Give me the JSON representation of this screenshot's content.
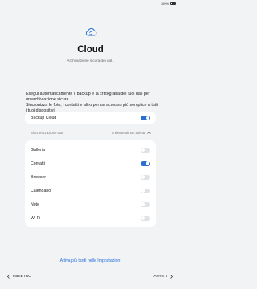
{
  "status_bar": {
    "battery": "100%"
  },
  "hero": {
    "icon": "cloud-sync-icon",
    "title": "Cloud",
    "subtitle": "Archiviazione sicura dei dati."
  },
  "description": {
    "line1": "Esegui automaticamente il backup e la crittografia dei tuoi dati per un'archiviazione sicura.",
    "line2": "Sincronizza le foto, i contatti e altro per un accesso più semplice a tutti i tuoi dispositivi."
  },
  "backup": {
    "label": "Backup Cloud",
    "enabled": true
  },
  "sync": {
    "header": "Sincronizzazione dati",
    "summary": "5 elementi non attivati",
    "items": [
      {
        "label": "Galleria",
        "enabled": false
      },
      {
        "label": "Contatti",
        "enabled": true
      },
      {
        "label": "Browser",
        "enabled": false
      },
      {
        "label": "Calendario",
        "enabled": false
      },
      {
        "label": "Note",
        "enabled": false
      },
      {
        "label": "Wi-Fi",
        "enabled": false
      }
    ]
  },
  "link": "Attiva più tardi nelle Impostazioni",
  "footer": {
    "back": "INDIETRO",
    "next": "AVANTI"
  },
  "colors": {
    "accent": "#2a6fd6",
    "background": "#f1f3f5"
  }
}
